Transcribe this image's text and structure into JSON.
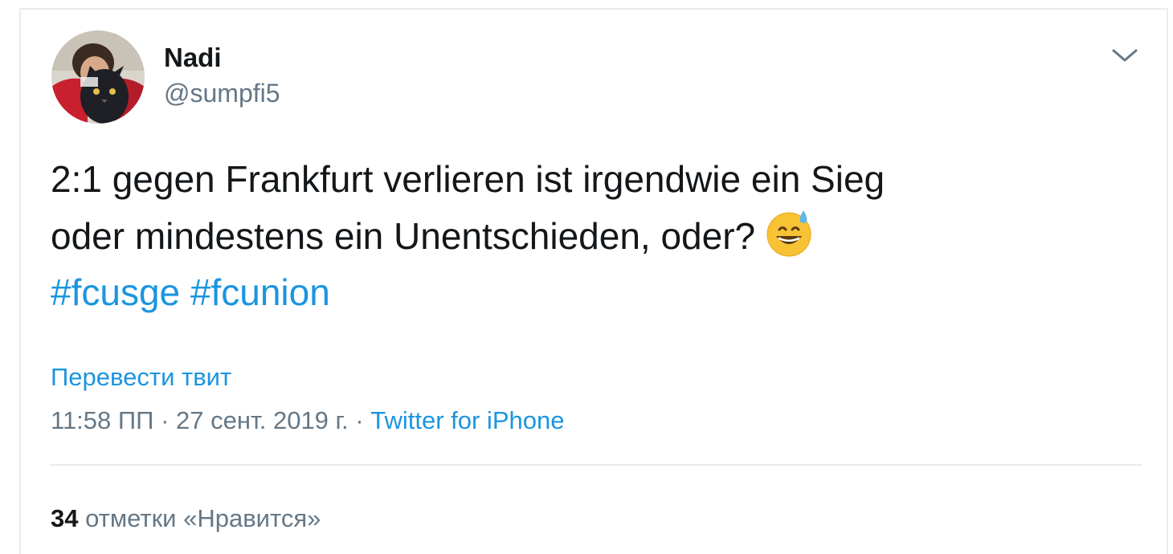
{
  "author": {
    "display_name": "Nadi",
    "handle": "@sumpfi5"
  },
  "tweet": {
    "line1": "2:1 gegen Frankfurt verlieren ist irgendwie ein Sieg",
    "line2": "oder mindestens ein Unentschieden, oder?",
    "emoji": "grinning-face-with-sweat",
    "hashtags": [
      "#fcusge",
      "#fcunion"
    ]
  },
  "translate_label": "Перевести твит",
  "meta": {
    "time": "11:58 ПП",
    "separator": " · ",
    "date": "27 сент. 2019 г.",
    "source": "Twitter for iPhone"
  },
  "likes": {
    "count": "34",
    "label": "отметки «Нравится»"
  },
  "colors": {
    "link": "#1b95e0",
    "text": "#14171a",
    "secondary": "#657786",
    "border": "#e6ecf0"
  }
}
